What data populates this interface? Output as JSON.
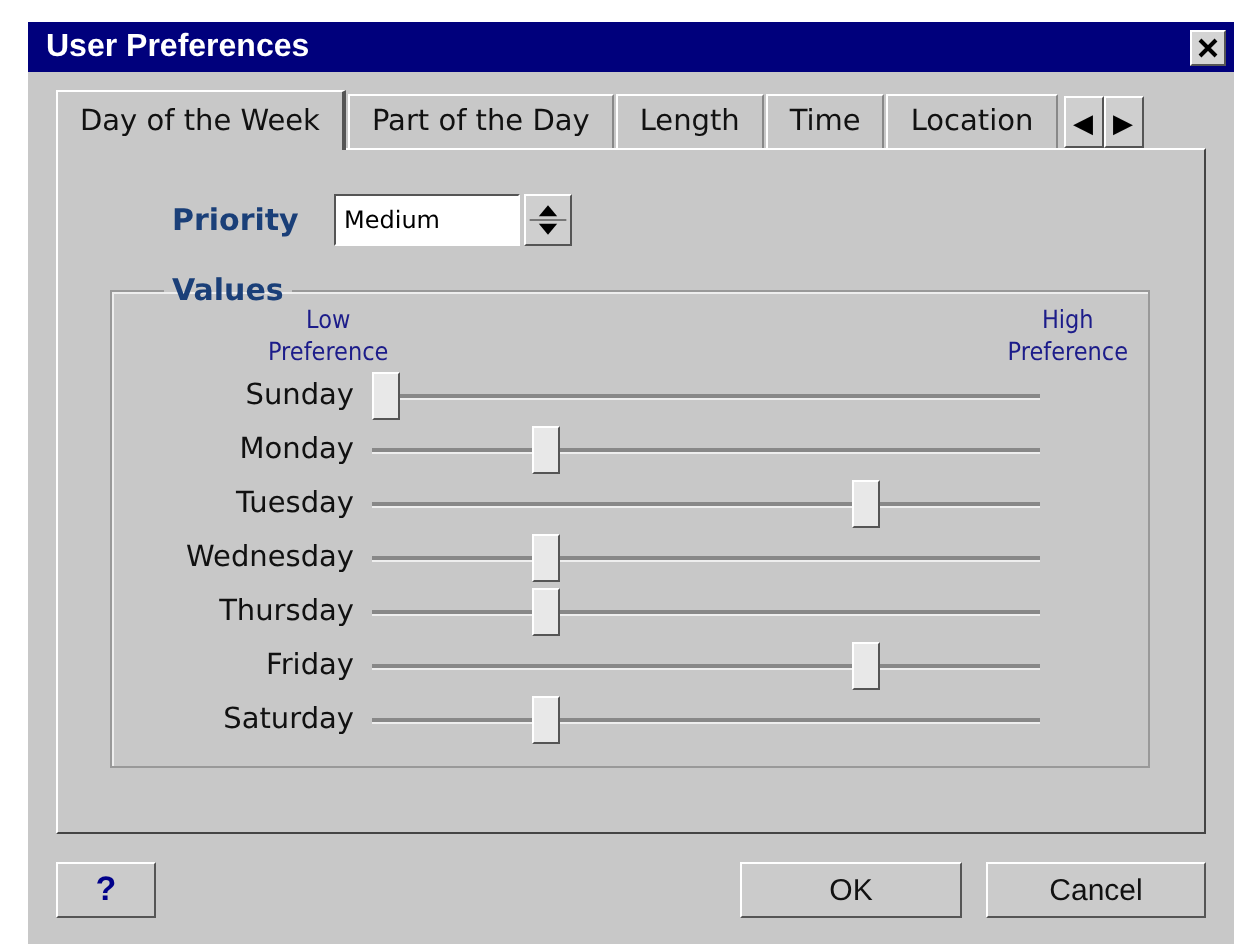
{
  "window": {
    "title": "User Preferences"
  },
  "tabs": [
    {
      "label": "Day of the Week",
      "selected": true
    },
    {
      "label": "Part of the Day",
      "selected": false
    },
    {
      "label": "Length",
      "selected": false
    },
    {
      "label": "Time",
      "selected": false
    },
    {
      "label": "Location",
      "selected": false
    }
  ],
  "tab_scroll": [
    "◀",
    "▶"
  ],
  "priority": {
    "label": "Priority",
    "value": "Medium"
  },
  "values": {
    "title": "Values",
    "low_label": "Low\nPreference",
    "high_label": "High\nPreference",
    "days": [
      {
        "name": "Sunday",
        "level": 0
      },
      {
        "name": "Monday",
        "level": 0.25
      },
      {
        "name": "Tuesday",
        "level": 0.75
      },
      {
        "name": "Wednesday",
        "level": 0.25
      },
      {
        "name": "Thursday",
        "level": 0.25
      },
      {
        "name": "Friday",
        "level": 0.75
      },
      {
        "name": "Saturday",
        "level": 0.25
      }
    ]
  },
  "buttons": {
    "help": "?",
    "ok": "OK",
    "cancel": "Cancel"
  }
}
